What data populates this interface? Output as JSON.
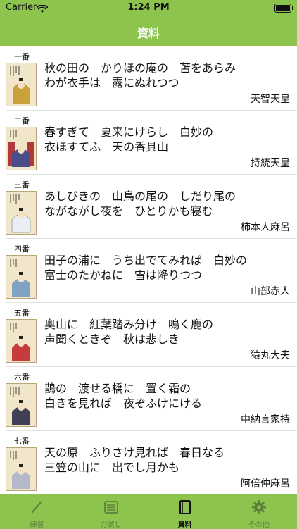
{
  "status": {
    "carrier": "Carrier",
    "time": "1:24 PM"
  },
  "nav": {
    "title": "資料"
  },
  "items": [
    {
      "num": "一番",
      "line1": "秋の田の　かりほの庵の　苫をあらみ",
      "line2": "わが衣手は　露にぬれつつ",
      "author": "天智天皇"
    },
    {
      "num": "二番",
      "line1": "春すぎて　夏来にけらし　白妙の",
      "line2": "衣ほすてふ　天の香具山",
      "author": "持統天皇"
    },
    {
      "num": "三番",
      "line1": "あしびきの　山鳥の尾の　しだり尾の",
      "line2": "ながながし夜を　ひとりかも寝む",
      "author": "柿本人麻呂"
    },
    {
      "num": "四番",
      "line1": "田子の浦に　うち出でてみれば　白妙の",
      "line2": "富士のたかねに　雪は降りつつ",
      "author": "山部赤人"
    },
    {
      "num": "五番",
      "line1": "奥山に　紅葉踏み分け　鳴く鹿の",
      "line2": "声聞くときぞ　秋は悲しき",
      "author": "猿丸大夫"
    },
    {
      "num": "六番",
      "line1": "鵲の　渡せる橋に　置く霜の",
      "line2": "白きを見れば　夜ぞふけにける",
      "author": "中納言家持"
    },
    {
      "num": "七番",
      "line1": "天の原　ふりさけ見れば　春日なる",
      "line2": "三笠の山に　出でし月かも",
      "author": "阿倍仲麻呂"
    }
  ],
  "tabs": [
    {
      "label": "練習",
      "icon": "pencil-icon",
      "active": false
    },
    {
      "label": "力試し",
      "icon": "list-icon",
      "active": false
    },
    {
      "label": "資料",
      "icon": "book-icon",
      "active": true
    },
    {
      "label": "その他",
      "icon": "gear-icon",
      "active": false
    }
  ],
  "colors": {
    "accent": "#8dc44e",
    "tab_inactive": "#5f7f3e",
    "tab_active": "#111111"
  }
}
